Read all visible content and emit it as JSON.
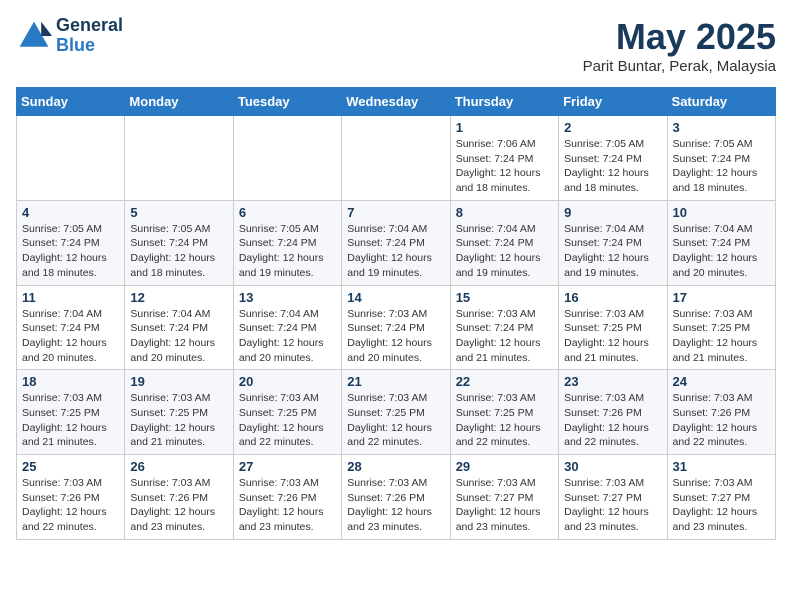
{
  "header": {
    "logo_line1": "General",
    "logo_line2": "Blue",
    "title": "May 2025",
    "subtitle": "Parit Buntar, Perak, Malaysia"
  },
  "days_of_week": [
    "Sunday",
    "Monday",
    "Tuesday",
    "Wednesday",
    "Thursday",
    "Friday",
    "Saturday"
  ],
  "weeks": [
    [
      {
        "day": "",
        "info": ""
      },
      {
        "day": "",
        "info": ""
      },
      {
        "day": "",
        "info": ""
      },
      {
        "day": "",
        "info": ""
      },
      {
        "day": "1",
        "info": "Sunrise: 7:06 AM\nSunset: 7:24 PM\nDaylight: 12 hours\nand 18 minutes."
      },
      {
        "day": "2",
        "info": "Sunrise: 7:05 AM\nSunset: 7:24 PM\nDaylight: 12 hours\nand 18 minutes."
      },
      {
        "day": "3",
        "info": "Sunrise: 7:05 AM\nSunset: 7:24 PM\nDaylight: 12 hours\nand 18 minutes."
      }
    ],
    [
      {
        "day": "4",
        "info": "Sunrise: 7:05 AM\nSunset: 7:24 PM\nDaylight: 12 hours\nand 18 minutes."
      },
      {
        "day": "5",
        "info": "Sunrise: 7:05 AM\nSunset: 7:24 PM\nDaylight: 12 hours\nand 18 minutes."
      },
      {
        "day": "6",
        "info": "Sunrise: 7:05 AM\nSunset: 7:24 PM\nDaylight: 12 hours\nand 19 minutes."
      },
      {
        "day": "7",
        "info": "Sunrise: 7:04 AM\nSunset: 7:24 PM\nDaylight: 12 hours\nand 19 minutes."
      },
      {
        "day": "8",
        "info": "Sunrise: 7:04 AM\nSunset: 7:24 PM\nDaylight: 12 hours\nand 19 minutes."
      },
      {
        "day": "9",
        "info": "Sunrise: 7:04 AM\nSunset: 7:24 PM\nDaylight: 12 hours\nand 19 minutes."
      },
      {
        "day": "10",
        "info": "Sunrise: 7:04 AM\nSunset: 7:24 PM\nDaylight: 12 hours\nand 20 minutes."
      }
    ],
    [
      {
        "day": "11",
        "info": "Sunrise: 7:04 AM\nSunset: 7:24 PM\nDaylight: 12 hours\nand 20 minutes."
      },
      {
        "day": "12",
        "info": "Sunrise: 7:04 AM\nSunset: 7:24 PM\nDaylight: 12 hours\nand 20 minutes."
      },
      {
        "day": "13",
        "info": "Sunrise: 7:04 AM\nSunset: 7:24 PM\nDaylight: 12 hours\nand 20 minutes."
      },
      {
        "day": "14",
        "info": "Sunrise: 7:03 AM\nSunset: 7:24 PM\nDaylight: 12 hours\nand 20 minutes."
      },
      {
        "day": "15",
        "info": "Sunrise: 7:03 AM\nSunset: 7:24 PM\nDaylight: 12 hours\nand 21 minutes."
      },
      {
        "day": "16",
        "info": "Sunrise: 7:03 AM\nSunset: 7:25 PM\nDaylight: 12 hours\nand 21 minutes."
      },
      {
        "day": "17",
        "info": "Sunrise: 7:03 AM\nSunset: 7:25 PM\nDaylight: 12 hours\nand 21 minutes."
      }
    ],
    [
      {
        "day": "18",
        "info": "Sunrise: 7:03 AM\nSunset: 7:25 PM\nDaylight: 12 hours\nand 21 minutes."
      },
      {
        "day": "19",
        "info": "Sunrise: 7:03 AM\nSunset: 7:25 PM\nDaylight: 12 hours\nand 21 minutes."
      },
      {
        "day": "20",
        "info": "Sunrise: 7:03 AM\nSunset: 7:25 PM\nDaylight: 12 hours\nand 22 minutes."
      },
      {
        "day": "21",
        "info": "Sunrise: 7:03 AM\nSunset: 7:25 PM\nDaylight: 12 hours\nand 22 minutes."
      },
      {
        "day": "22",
        "info": "Sunrise: 7:03 AM\nSunset: 7:25 PM\nDaylight: 12 hours\nand 22 minutes."
      },
      {
        "day": "23",
        "info": "Sunrise: 7:03 AM\nSunset: 7:26 PM\nDaylight: 12 hours\nand 22 minutes."
      },
      {
        "day": "24",
        "info": "Sunrise: 7:03 AM\nSunset: 7:26 PM\nDaylight: 12 hours\nand 22 minutes."
      }
    ],
    [
      {
        "day": "25",
        "info": "Sunrise: 7:03 AM\nSunset: 7:26 PM\nDaylight: 12 hours\nand 22 minutes."
      },
      {
        "day": "26",
        "info": "Sunrise: 7:03 AM\nSunset: 7:26 PM\nDaylight: 12 hours\nand 23 minutes."
      },
      {
        "day": "27",
        "info": "Sunrise: 7:03 AM\nSunset: 7:26 PM\nDaylight: 12 hours\nand 23 minutes."
      },
      {
        "day": "28",
        "info": "Sunrise: 7:03 AM\nSunset: 7:26 PM\nDaylight: 12 hours\nand 23 minutes."
      },
      {
        "day": "29",
        "info": "Sunrise: 7:03 AM\nSunset: 7:27 PM\nDaylight: 12 hours\nand 23 minutes."
      },
      {
        "day": "30",
        "info": "Sunrise: 7:03 AM\nSunset: 7:27 PM\nDaylight: 12 hours\nand 23 minutes."
      },
      {
        "day": "31",
        "info": "Sunrise: 7:03 AM\nSunset: 7:27 PM\nDaylight: 12 hours\nand 23 minutes."
      }
    ]
  ]
}
